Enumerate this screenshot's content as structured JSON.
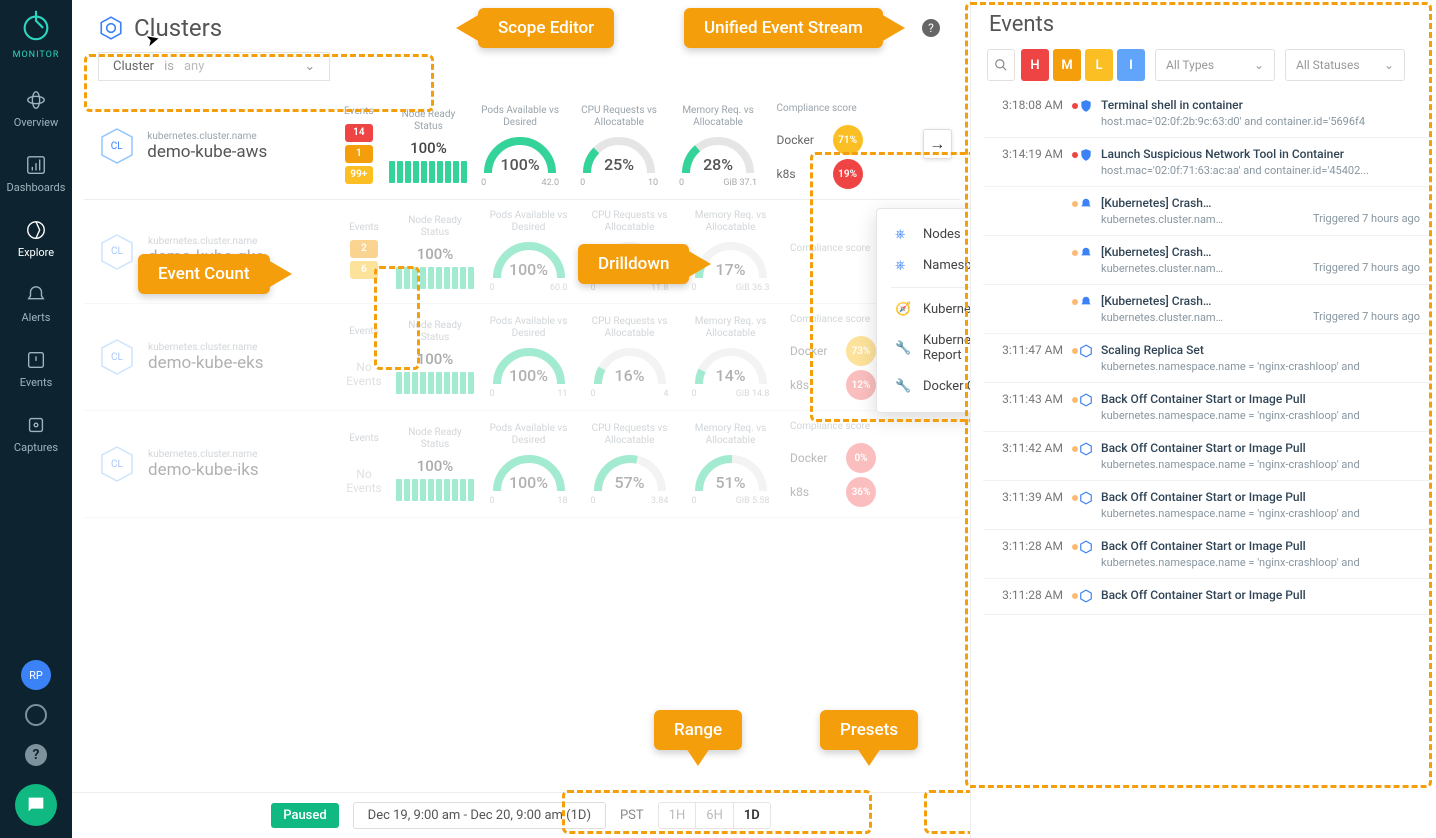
{
  "brand": "MONITOR",
  "nav": [
    {
      "label": "Overview"
    },
    {
      "label": "Dashboards"
    },
    {
      "label": "Explore",
      "active": true
    },
    {
      "label": "Alerts"
    },
    {
      "label": "Events"
    },
    {
      "label": "Captures"
    }
  ],
  "avatar": "RP",
  "page_title": "Clusters",
  "scope": {
    "field": "Cluster",
    "op": "is",
    "value": "any"
  },
  "col_hdr": {
    "events": "Events",
    "ready": "Node Ready Status",
    "pods": "Pods Available vs Desired",
    "cpu": "CPU Requests vs Allocatable",
    "mem": "Memory Req. vs Allocatable",
    "comp": "Compliance score"
  },
  "clusters": [
    {
      "label": "kubernetes.cluster.name",
      "name": "demo-kube-aws",
      "events": {
        "h": "14",
        "m": "1",
        "l": "99+"
      },
      "ready": "100%",
      "pods": {
        "val": "100%",
        "min": "0",
        "max": "42.0"
      },
      "cpu": {
        "val": "25%",
        "min": "0",
        "max": "10"
      },
      "mem": {
        "val": "28%",
        "min": "0",
        "max": "37.1",
        "unit": "GiB"
      },
      "comp": [
        {
          "name": "Docker",
          "pct": "71%",
          "cls": "pill-y"
        },
        {
          "name": "k8s",
          "pct": "19%",
          "cls": "pill-rr"
        }
      ],
      "drill": true
    },
    {
      "label": "kubernetes.cluster.name",
      "name": "demo-kube-gke",
      "events": {
        "h": "",
        "m": "2",
        "l": "6"
      },
      "ready": "100%",
      "pods": {
        "val": "100%",
        "min": "0",
        "max": "60.0"
      },
      "cpu": {
        "val": "24%",
        "min": "0",
        "max": "11.8"
      },
      "mem": {
        "val": "17%",
        "min": "0",
        "max": "36.3",
        "unit": "GiB"
      },
      "fade": true
    },
    {
      "label": "kubernetes.cluster.name",
      "name": "demo-kube-eks",
      "noev": "No Events",
      "ready": "100%",
      "pods": {
        "val": "100%",
        "min": "0",
        "max": "11"
      },
      "cpu": {
        "val": "16%",
        "min": "0",
        "max": "4"
      },
      "mem": {
        "val": "14%",
        "min": "0",
        "max": "14.8",
        "unit": "GiB"
      },
      "comp": [
        {
          "name": "Docker",
          "pct": "73%",
          "cls": "pill-y"
        },
        {
          "name": "k8s",
          "pct": "12%",
          "cls": "pill-r"
        }
      ],
      "fade": true
    },
    {
      "label": "kubernetes.cluster.name",
      "name": "demo-kube-iks",
      "noev": "No Events",
      "ready": "100%",
      "pods": {
        "val": "100%",
        "min": "0",
        "max": "18"
      },
      "cpu": {
        "val": "57%",
        "min": "0",
        "max": "3.84"
      },
      "mem": {
        "val": "51%",
        "min": "0",
        "max": "5.58",
        "unit": "GiB"
      },
      "comp": [
        {
          "name": "Docker",
          "pct": "0%",
          "cls": "pill-r"
        },
        {
          "name": "k8s",
          "pct": "36%",
          "cls": "pill-r"
        }
      ],
      "fade": true
    }
  ],
  "drill_menu": [
    "Nodes",
    "Namespaces",
    "Kubernetes Cluster Overview",
    "Kubernetes Compliance Report",
    "Docker Compliance Report"
  ],
  "events_panel": {
    "title": "Events",
    "sev": [
      "H",
      "M",
      "L",
      "I"
    ],
    "types": "All Types",
    "statuses": "All Statuses",
    "items": [
      {
        "t": "3:18:08 AM",
        "icon": "shield",
        "title": "Terminal shell in container",
        "desc": "host.mac='02:0f:2b:9c:63:d0' and container.id='5696f4",
        "red": true
      },
      {
        "t": "3:14:19 AM",
        "icon": "shield",
        "title": "Launch Suspicious Network Tool in Container",
        "desc": "host.mac='02:0f:71:63:ac:aa' and container.id='45402...",
        "red": true
      },
      {
        "t": "",
        "icon": "bell",
        "title": "[Kubernetes] Crash…",
        "desc": "kubernetes.cluster.nam…",
        "trig": "Triggered 7 hours ago"
      },
      {
        "t": "",
        "icon": "bell",
        "title": "[Kubernetes] Crash…",
        "desc": "kubernetes.cluster.nam…",
        "trig": "Triggered 7 hours ago"
      },
      {
        "t": "",
        "icon": "bell",
        "title": "[Kubernetes] Crash…",
        "desc": "kubernetes.cluster.nam…",
        "trig": "Triggered 7 hours ago"
      },
      {
        "t": "3:11:47 AM",
        "icon": "k8s",
        "title": "Scaling Replica Set",
        "desc": "kubernetes.namespace.name = 'nginx-crashloop' and"
      },
      {
        "t": "3:11:43 AM",
        "icon": "k8s",
        "title": "Back Off Container Start or Image Pull",
        "desc": "kubernetes.namespace.name = 'nginx-crashloop' and"
      },
      {
        "t": "3:11:42 AM",
        "icon": "k8s",
        "title": "Back Off Container Start or Image Pull",
        "desc": "kubernetes.namespace.name = 'nginx-crashloop' and"
      },
      {
        "t": "3:11:39 AM",
        "icon": "k8s",
        "title": "Back Off Container Start or Image Pull",
        "desc": "kubernetes.namespace.name = 'nginx-crashloop' and"
      },
      {
        "t": "3:11:28 AM",
        "icon": "k8s",
        "title": "Back Off Container Start or Image Pull",
        "desc": "kubernetes.namespace.name = 'nginx-crashloop' and"
      },
      {
        "t": "3:11:28 AM",
        "icon": "k8s",
        "title": "Back Off Container Start or Image Pull",
        "desc": ""
      }
    ]
  },
  "bottom": {
    "paused": "Paused",
    "range": "Dec 19, 9:00 am - Dec 20, 9:00 am (1D)",
    "tz": "PST",
    "presets": [
      "1H",
      "6H",
      "1D"
    ],
    "active": "1D"
  },
  "ann": {
    "scope": "Scope Editor",
    "stream": "Unified Event Stream",
    "count": "Event Count",
    "drill": "Drilldown",
    "range": "Range",
    "presets": "Presets"
  }
}
